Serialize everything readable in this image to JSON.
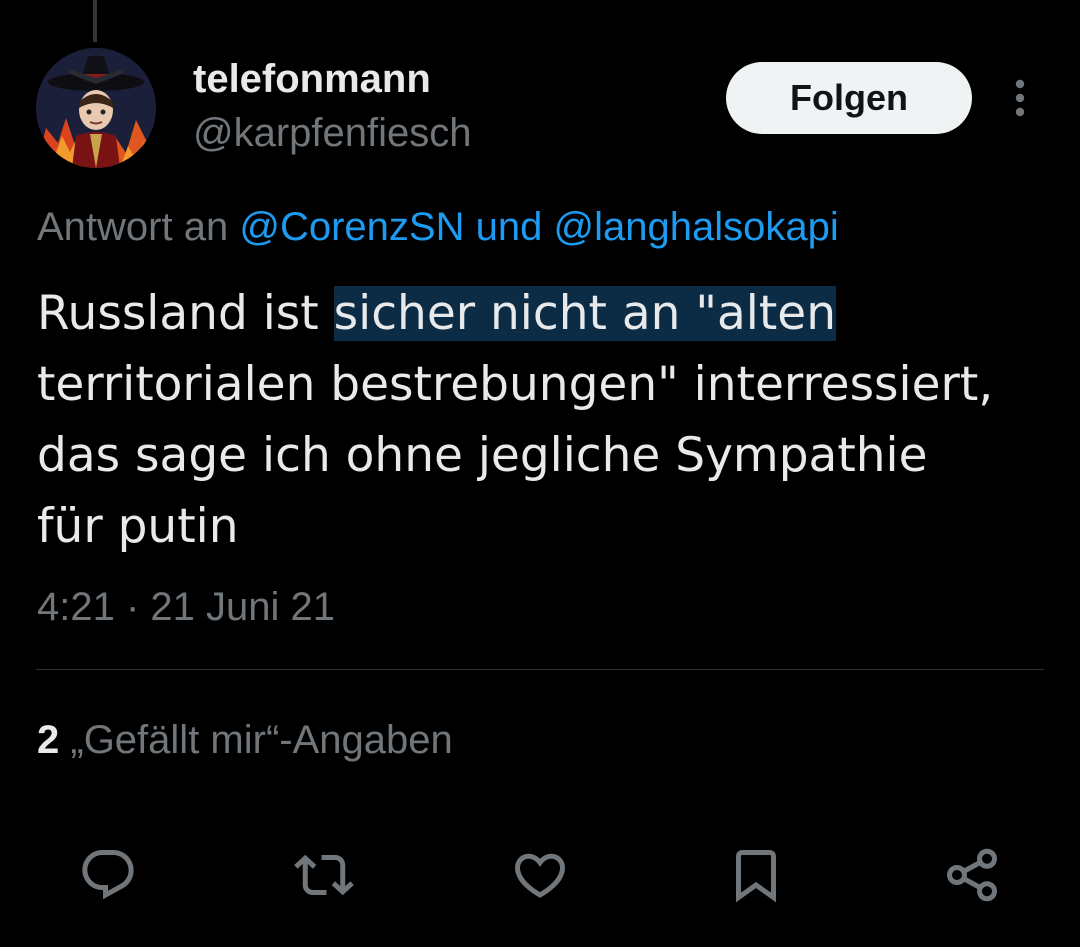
{
  "author": {
    "display_name": "telefonmann",
    "handle": "@karpfenfiesch"
  },
  "follow_button": {
    "label": "Folgen"
  },
  "reply_to": {
    "prefix": "Antwort an",
    "mention_1": "@CorenzSN",
    "conjunction": "und",
    "mention_2": "@langhalsokapi"
  },
  "tweet": {
    "line1_before": "Russland ist ",
    "line1_highlighted": "sicher nicht an \"alten",
    "line2": "territorialen bestrebungen\" interressiert,",
    "line3": "das sage ich ohne jegliche Sympathie",
    "line4": "für putin",
    "timestamp": "4:21 · 21 Juni 21"
  },
  "stats": {
    "likes_count": "2",
    "likes_label": "„Gefällt mir“-Angaben"
  },
  "icons": {
    "more": "more-vertical-icon",
    "reply": "reply-icon",
    "retweet": "retweet-icon",
    "like": "heart-icon",
    "bookmark": "bookmark-icon",
    "share": "share-icon"
  },
  "colors": {
    "background": "#000000",
    "text_primary": "#e7e9ea",
    "text_secondary": "#71767b",
    "accent": "#1d9bf0",
    "highlight": "#0c2b44",
    "follow_button_bg": "#eff3f4"
  }
}
